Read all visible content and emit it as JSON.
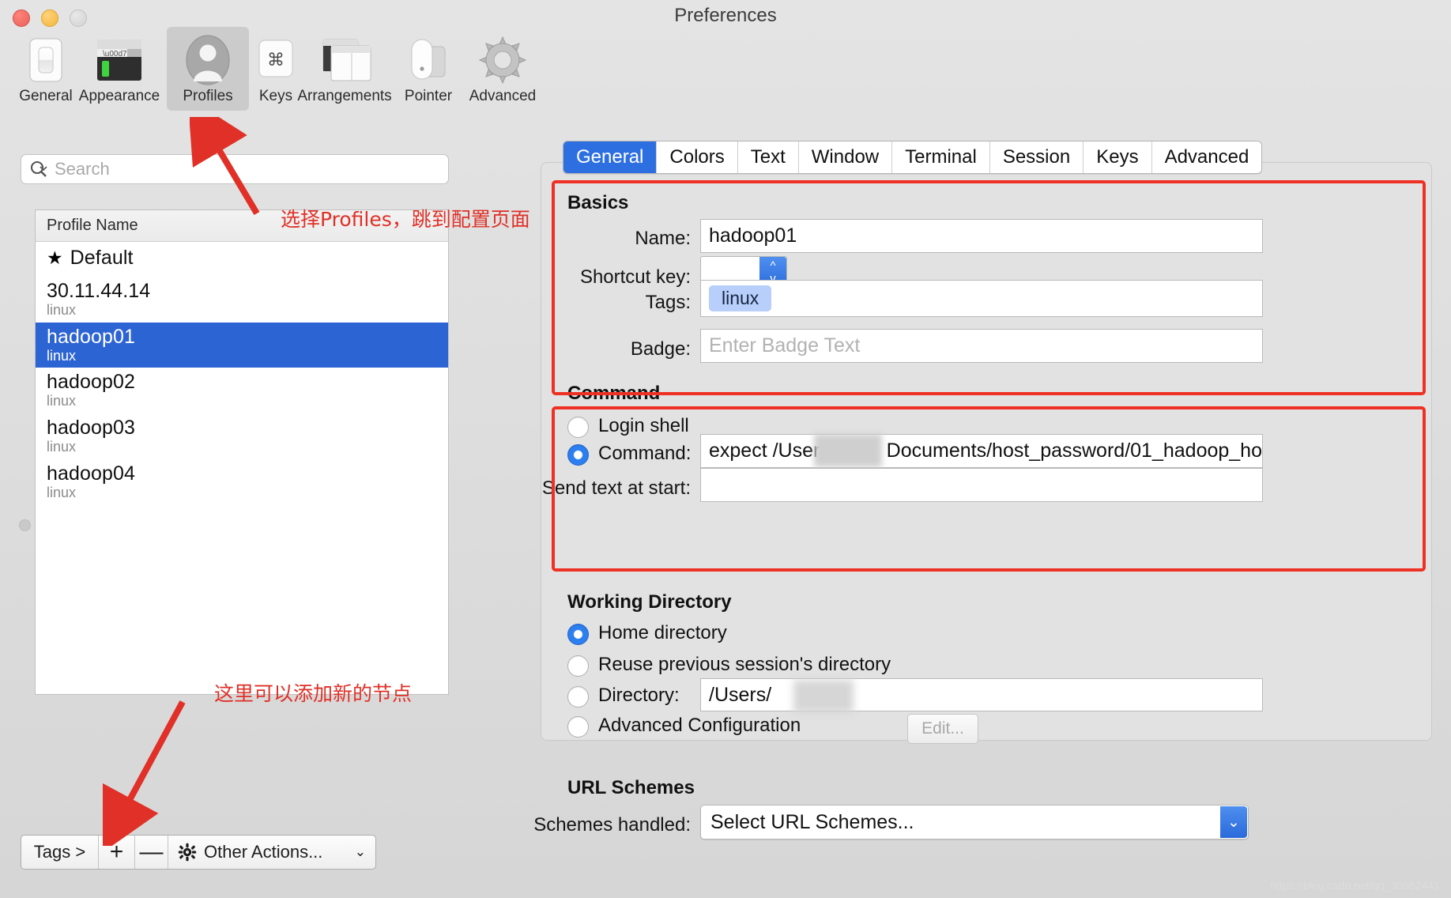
{
  "window": {
    "title": "Preferences",
    "traffic_lights": [
      "close",
      "minimize",
      "zoom"
    ]
  },
  "toolbar": {
    "items": [
      {
        "label": "General",
        "icon": "general-switch-icon",
        "selected": false
      },
      {
        "label": "Appearance",
        "icon": "appearance-terminal-icon",
        "selected": false
      },
      {
        "label": "Profiles",
        "icon": "profiles-person-icon",
        "selected": true
      },
      {
        "label": "Keys",
        "icon": "keys-command-icon",
        "selected": false
      },
      {
        "label": "Arrangements",
        "icon": "arrangements-windows-icon",
        "selected": false
      },
      {
        "label": "Pointer",
        "icon": "pointer-mouse-icon",
        "selected": false
      },
      {
        "label": "Advanced",
        "icon": "advanced-gear-icon",
        "selected": false
      }
    ]
  },
  "sidebar": {
    "search": {
      "placeholder": "Search",
      "value": ""
    },
    "column_header": "Profile Name",
    "profiles": [
      {
        "name": "Default",
        "tag": "",
        "star": "★",
        "selected": false
      },
      {
        "name": "30.11.44.14",
        "tag": "linux",
        "star": "",
        "selected": false
      },
      {
        "name": "hadoop01",
        "tag": "linux",
        "star": "",
        "selected": true
      },
      {
        "name": "hadoop02",
        "tag": "linux",
        "star": "",
        "selected": false
      },
      {
        "name": "hadoop03",
        "tag": "linux",
        "star": "",
        "selected": false
      },
      {
        "name": "hadoop04",
        "tag": "linux",
        "star": "",
        "selected": false
      }
    ],
    "bottom_bar": {
      "tags_label": "Tags >",
      "add_label": "+",
      "remove_label": "—",
      "other_actions_label": "Other Actions...",
      "other_actions_icon": "gear-icon",
      "chevron": "⌄"
    }
  },
  "tabs": [
    {
      "label": "General",
      "active": true
    },
    {
      "label": "Colors",
      "active": false
    },
    {
      "label": "Text",
      "active": false
    },
    {
      "label": "Window",
      "active": false
    },
    {
      "label": "Terminal",
      "active": false
    },
    {
      "label": "Session",
      "active": false
    },
    {
      "label": "Keys",
      "active": false
    },
    {
      "label": "Advanced",
      "active": false
    }
  ],
  "basics": {
    "title": "Basics",
    "name_label": "Name:",
    "name_value": "hadoop01",
    "shortcut_label": "Shortcut key:",
    "shortcut_value": "",
    "tags_label": "Tags:",
    "tags_chips": [
      "linux"
    ],
    "badge_label": "Badge:",
    "badge_placeholder": "Enter Badge Text",
    "badge_value": ""
  },
  "command": {
    "title": "Command",
    "login_shell_label": "Login shell",
    "login_shell_selected": false,
    "command_label": "Command:",
    "command_selected": true,
    "command_value_prefix": "expect /Users",
    "command_value_suffix": "Documents/host_password/01_hadoop_ho",
    "send_text_label": "Send text at start:",
    "send_text_value": ""
  },
  "working_directory": {
    "title": "Working Directory",
    "options": [
      {
        "label": "Home directory",
        "selected": true
      },
      {
        "label": "Reuse previous session's directory",
        "selected": false
      },
      {
        "label": "Directory:",
        "selected": false
      },
      {
        "label": "Advanced Configuration",
        "selected": false
      }
    ],
    "directory_value": "/Users/",
    "edit_button_label": "Edit..."
  },
  "url_schemes": {
    "title": "URL Schemes",
    "schemes_label": "Schemes handled:",
    "schemes_value": "Select URL Schemes...",
    "chevron": "⌄"
  },
  "annotations": [
    {
      "text": "选择Profiles，跳到配置页面",
      "name": "annotation-select-profiles"
    },
    {
      "text": "这里可以添加新的节点",
      "name": "annotation-add-node"
    }
  ],
  "watermark": "https://blog.csdn.net/qq_30552441",
  "colors": {
    "accent_blue": "#2d6fe0",
    "selection_blue": "#2c64d4",
    "annotation_red": "#e03027",
    "highlight_box_red": "#ee3124",
    "tag_chip_blue": "#b7cffa"
  }
}
